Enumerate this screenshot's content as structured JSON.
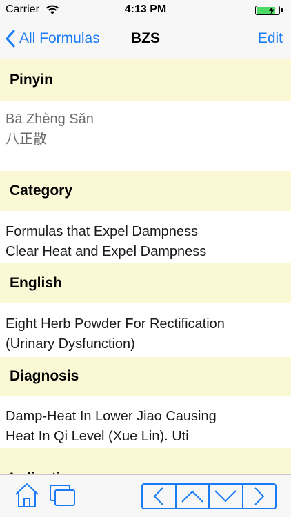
{
  "status_bar": {
    "carrier": "Carrier",
    "time": "4:13 PM",
    "battery_level": 0.85
  },
  "nav": {
    "back_label": "All Formulas",
    "title": "BZS",
    "edit_label": "Edit"
  },
  "sections": {
    "pinyin": {
      "header": "Pinyin",
      "lines": [
        "Bā Zhèng Sǎn",
        "八正散"
      ]
    },
    "category": {
      "header": "Category",
      "lines": [
        "Formulas that Expel Dampness",
        "Clear Heat and Expel Dampness"
      ]
    },
    "english": {
      "header": "English",
      "lines": [
        "Eight Herb Powder For Rectification",
        "(Urinary Dysfunction)"
      ]
    },
    "diagnosis": {
      "header": "Diagnosis",
      "lines": [
        "Damp-Heat In Lower Jiao Causing",
        "Heat In Qi Level (Xue Lin). Uti"
      ]
    },
    "indications": {
      "header": "Indications"
    }
  },
  "toolbar": {
    "icons": [
      "home-icon",
      "windows-icon",
      "previous-icon",
      "up-icon",
      "down-icon",
      "next-icon"
    ]
  },
  "colors": {
    "accent": "#1a7cf5",
    "section_header_bg": "#faf8d5",
    "battery": "#4cd964"
  }
}
